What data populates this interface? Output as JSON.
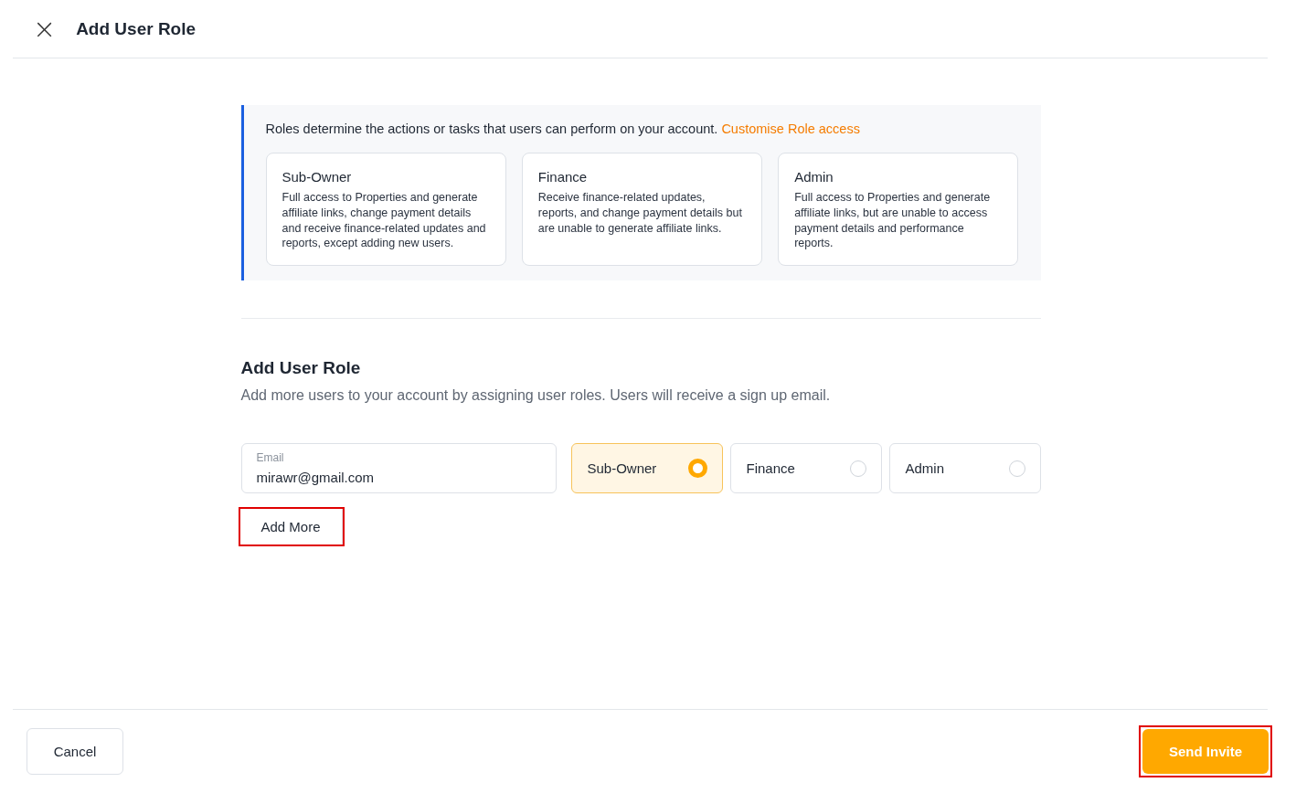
{
  "header": {
    "close": "×",
    "title": "Add User Role"
  },
  "info": {
    "text": "Roles determine the actions or tasks that users can perform on your account.",
    "link": "Customise Role access",
    "roles": [
      {
        "name": "Sub-Owner",
        "description": "Full access to Properties and generate affiliate links, change payment details and receive finance-related updates and reports, except adding new users."
      },
      {
        "name": "Finance",
        "description": "Receive finance-related updates, reports, and change payment details but are unable to generate affiliate links."
      },
      {
        "name": "Admin",
        "description": "Full access to Properties and generate affiliate links, but are unable to access payment details and performance reports."
      }
    ]
  },
  "form": {
    "title": "Add User Role",
    "subtitle": "Add more users to your account by assigning user roles. Users will receive a sign up email.",
    "email": {
      "label": "Email",
      "value": "mirawr@gmail.com"
    },
    "options": [
      {
        "label": "Sub-Owner",
        "selected": true
      },
      {
        "label": "Finance",
        "selected": false
      },
      {
        "label": "Admin",
        "selected": false
      }
    ],
    "add_more": {
      "label": "Add More",
      "highlighted": true
    }
  },
  "footer": {
    "cancel": {
      "label": "Cancel",
      "highlighted": false
    },
    "send": {
      "label": "Send Invite",
      "highlighted": true
    }
  }
}
